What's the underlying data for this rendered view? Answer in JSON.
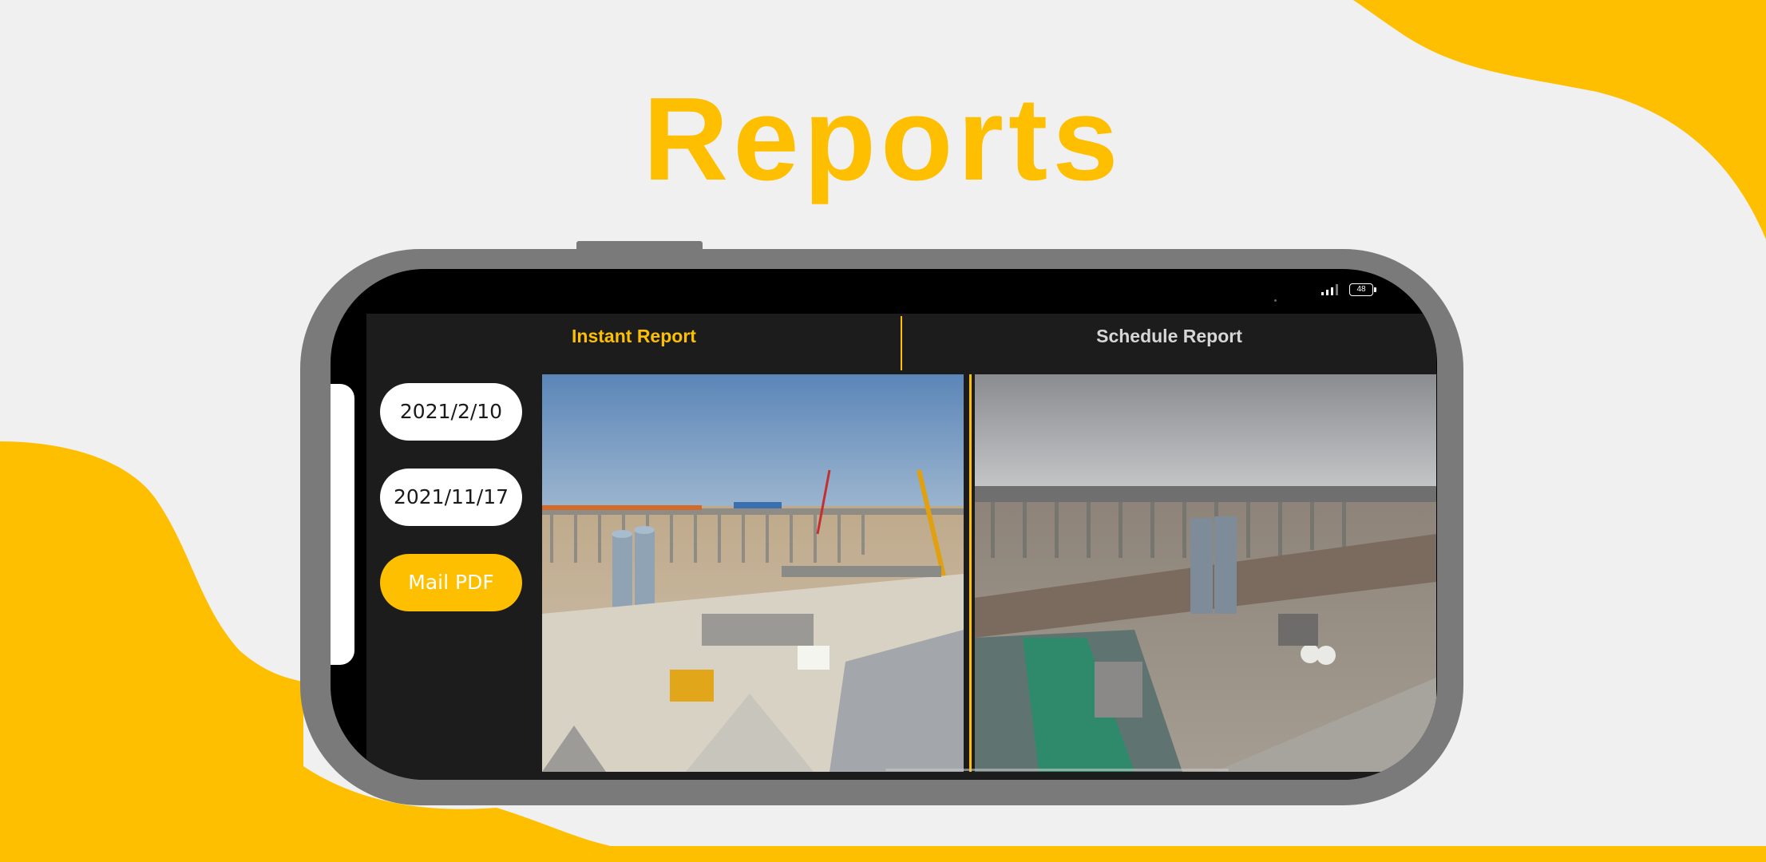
{
  "page": {
    "title": "Reports"
  },
  "colors": {
    "accent": "#fdbf00",
    "app_background": "#1c1c1c",
    "frame": "#7a7a7a",
    "page_background": "#f0f0f0"
  },
  "status_bar": {
    "signal_icon": "cellular-signal-icon",
    "battery_level": "48"
  },
  "tabs": [
    {
      "label": "Instant Report",
      "active": true
    },
    {
      "label": "Schedule Report",
      "active": false
    }
  ],
  "sidebar": {
    "start_date": "2021/2/10",
    "end_date": "2021/11/17",
    "mail_button": "Mail PDF"
  },
  "viewer": {
    "left_photo": "construction-site-photo-sunny",
    "right_photo": "construction-site-photo-overcast"
  }
}
